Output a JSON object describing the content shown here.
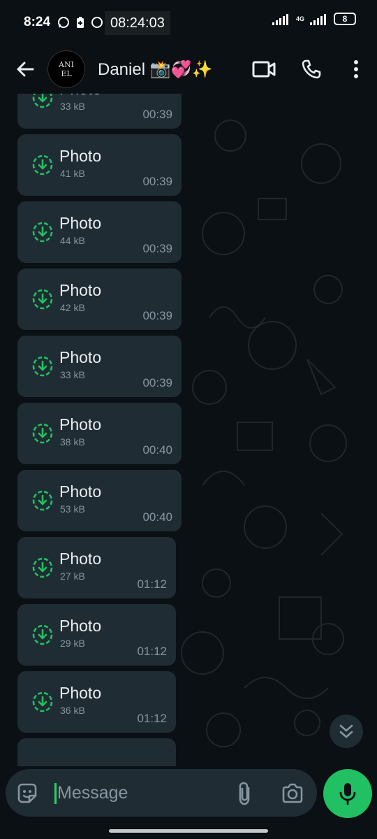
{
  "status_bar": {
    "time": "8:24",
    "overlay_time": "08:24:03",
    "network": "4G",
    "battery": "8"
  },
  "header": {
    "contact_name": "Daniel 📸💞✨",
    "avatar_text_line1": "ANI",
    "avatar_text_line2": "EL"
  },
  "messages": [
    {
      "title": "Photo",
      "size": "33 kB",
      "time": "00:39"
    },
    {
      "title": "Photo",
      "size": "41 kB",
      "time": "00:39"
    },
    {
      "title": "Photo",
      "size": "44 kB",
      "time": "00:39"
    },
    {
      "title": "Photo",
      "size": "42 kB",
      "time": "00:39"
    },
    {
      "title": "Photo",
      "size": "33 kB",
      "time": "00:39"
    },
    {
      "title": "Photo",
      "size": "38 kB",
      "time": "00:40"
    },
    {
      "title": "Photo",
      "size": "53 kB",
      "time": "00:40"
    },
    {
      "title": "Photo",
      "size": "27 kB",
      "time": "01:12"
    },
    {
      "title": "Photo",
      "size": "29 kB",
      "time": "01:12"
    },
    {
      "title": "Photo",
      "size": "36 kB",
      "time": "01:12"
    }
  ],
  "composer": {
    "placeholder": "Message"
  },
  "colors": {
    "accent": "#21c063",
    "bubble": "#202c33",
    "background": "#0b1014",
    "secondary_text": "#8696a0"
  },
  "icons": {
    "back": "arrow-left-icon",
    "video": "video-call-icon",
    "phone": "phone-icon",
    "menu": "more-vertical-icon",
    "download": "download-icon",
    "emoji": "sticker-icon",
    "attach": "paperclip-icon",
    "camera": "camera-icon",
    "mic": "microphone-icon",
    "scroll": "double-chevron-down-icon"
  }
}
